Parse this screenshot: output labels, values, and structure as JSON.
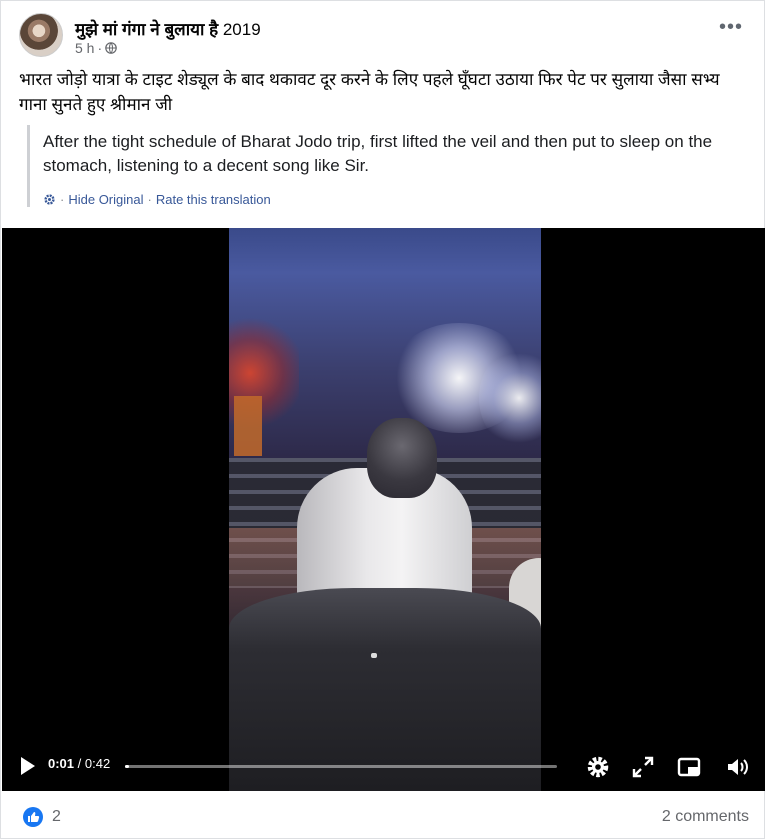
{
  "header": {
    "page_name": "मुझे मां गंगा ने बुलाया है",
    "page_name_year": "2019",
    "time_ago": "5 h",
    "separator": "·",
    "more_label": "•••"
  },
  "post": {
    "caption": "भारत जोड़ो यात्रा के टाइट शेड्यूल के बाद थकावट दूर करने के लिए पहले घूँघटा उठाया फिर पेट पर सुलाया जैसा सभ्य गाना सुनते हुए श्रीमान जी",
    "translation": "After the tight schedule of Bharat Jodo trip, first lifted the veil and then put to sleep on the stomach, listening to a decent song like Sir.",
    "hide_original": "Hide Original",
    "rate_translation": "Rate this translation",
    "link_separator": "·"
  },
  "video": {
    "current_time": "0:01",
    "total_time": "/ 0:42",
    "progress_fraction": 0.01
  },
  "footer": {
    "reaction_count": "2",
    "comments": "2 comments"
  },
  "colors": {
    "link": "#385898",
    "meta": "#65676b",
    "like": "#1877f2"
  },
  "icons": [
    "globe-icon",
    "more-icon",
    "gear-icon",
    "play-icon",
    "settings-icon",
    "expand-icon",
    "picture-in-picture-icon",
    "volume-icon",
    "like-icon"
  ]
}
